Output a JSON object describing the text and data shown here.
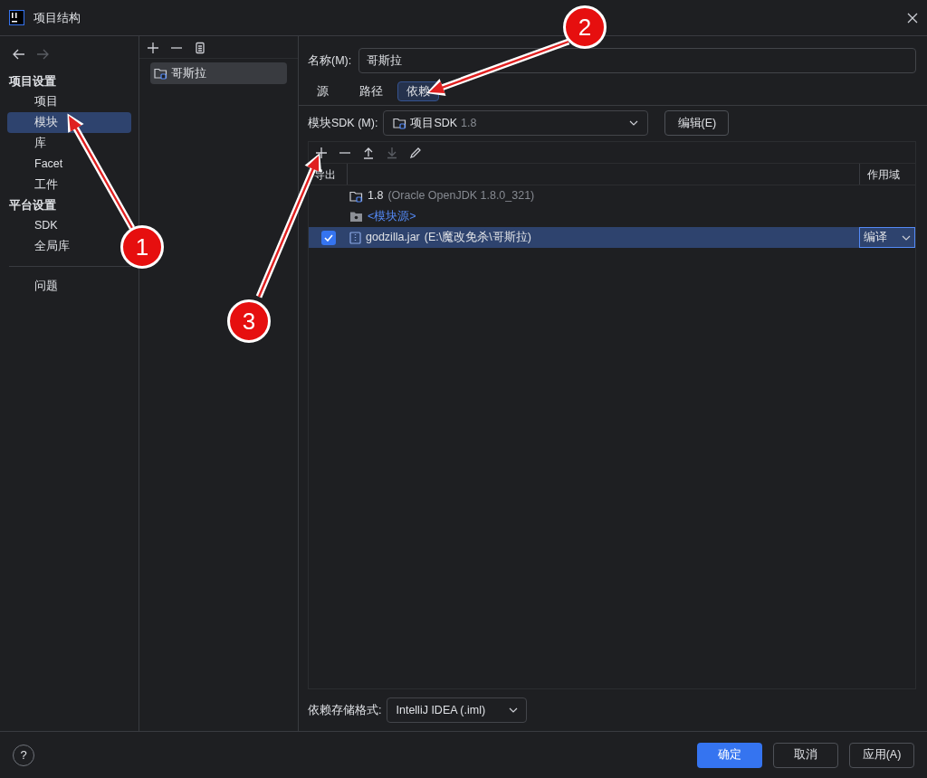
{
  "window": {
    "title": "项目结构"
  },
  "nav": [
    {
      "kind": "back",
      "disabled": false
    },
    {
      "kind": "forward",
      "disabled": true
    }
  ],
  "sidebar": {
    "sections": [
      {
        "title": "项目设置",
        "items": [
          {
            "label": "项目",
            "selected": false
          },
          {
            "label": "模块",
            "selected": true
          },
          {
            "label": "库",
            "selected": false
          },
          {
            "label": "Facet",
            "selected": false
          },
          {
            "label": "工件",
            "selected": false
          }
        ]
      },
      {
        "title": "平台设置",
        "items": [
          {
            "label": "SDK",
            "selected": false
          },
          {
            "label": "全局库",
            "selected": false
          }
        ]
      }
    ],
    "extra_items": [
      {
        "label": "问题",
        "selected": false
      }
    ]
  },
  "module_list": {
    "toolbar": [
      {
        "kind": "add",
        "disabled": false
      },
      {
        "kind": "remove",
        "disabled": false
      },
      {
        "kind": "copy",
        "disabled": false
      }
    ],
    "items": [
      {
        "label": "哥斯拉",
        "selected": true
      }
    ]
  },
  "name_field": {
    "label": "名称(M):",
    "value": "哥斯拉"
  },
  "tabs": [
    {
      "label": "源",
      "selected": false
    },
    {
      "label": "路径",
      "selected": false
    },
    {
      "label": "依赖",
      "selected": true
    }
  ],
  "sdk": {
    "label": "模块SDK (M):",
    "value": "项目SDK",
    "version": "1.8",
    "edit_button": "编辑(E)"
  },
  "dependencies": {
    "toolbar": [
      {
        "kind": "add",
        "disabled": false
      },
      {
        "kind": "remove",
        "disabled": false
      },
      {
        "kind": "up",
        "disabled": false
      },
      {
        "kind": "down",
        "disabled": true
      },
      {
        "kind": "edit",
        "disabled": false
      }
    ],
    "columns": [
      "导出",
      "作用域"
    ],
    "rows": [
      {
        "kind": "sdk",
        "name": "1.8",
        "detail": "(Oracle OpenJDK 1.8.0_321)"
      },
      {
        "kind": "source",
        "name": "<模块源>"
      },
      {
        "kind": "jar",
        "name": "godzilla.jar",
        "detail": "(E:\\魔改免杀\\哥斯拉)",
        "checked": true,
        "selected": true,
        "scope": "编译"
      }
    ]
  },
  "storage_format": {
    "label": "依赖存储格式:",
    "value": "IntelliJ IDEA (.iml)"
  },
  "footer": {
    "help": "?",
    "buttons": [
      {
        "label": "确定",
        "primary": true
      },
      {
        "label": "取消",
        "primary": false
      },
      {
        "label": "应用(A)",
        "primary": false
      }
    ]
  },
  "annotations": [
    {
      "number": "1"
    },
    {
      "number": "2"
    },
    {
      "number": "3"
    }
  ]
}
